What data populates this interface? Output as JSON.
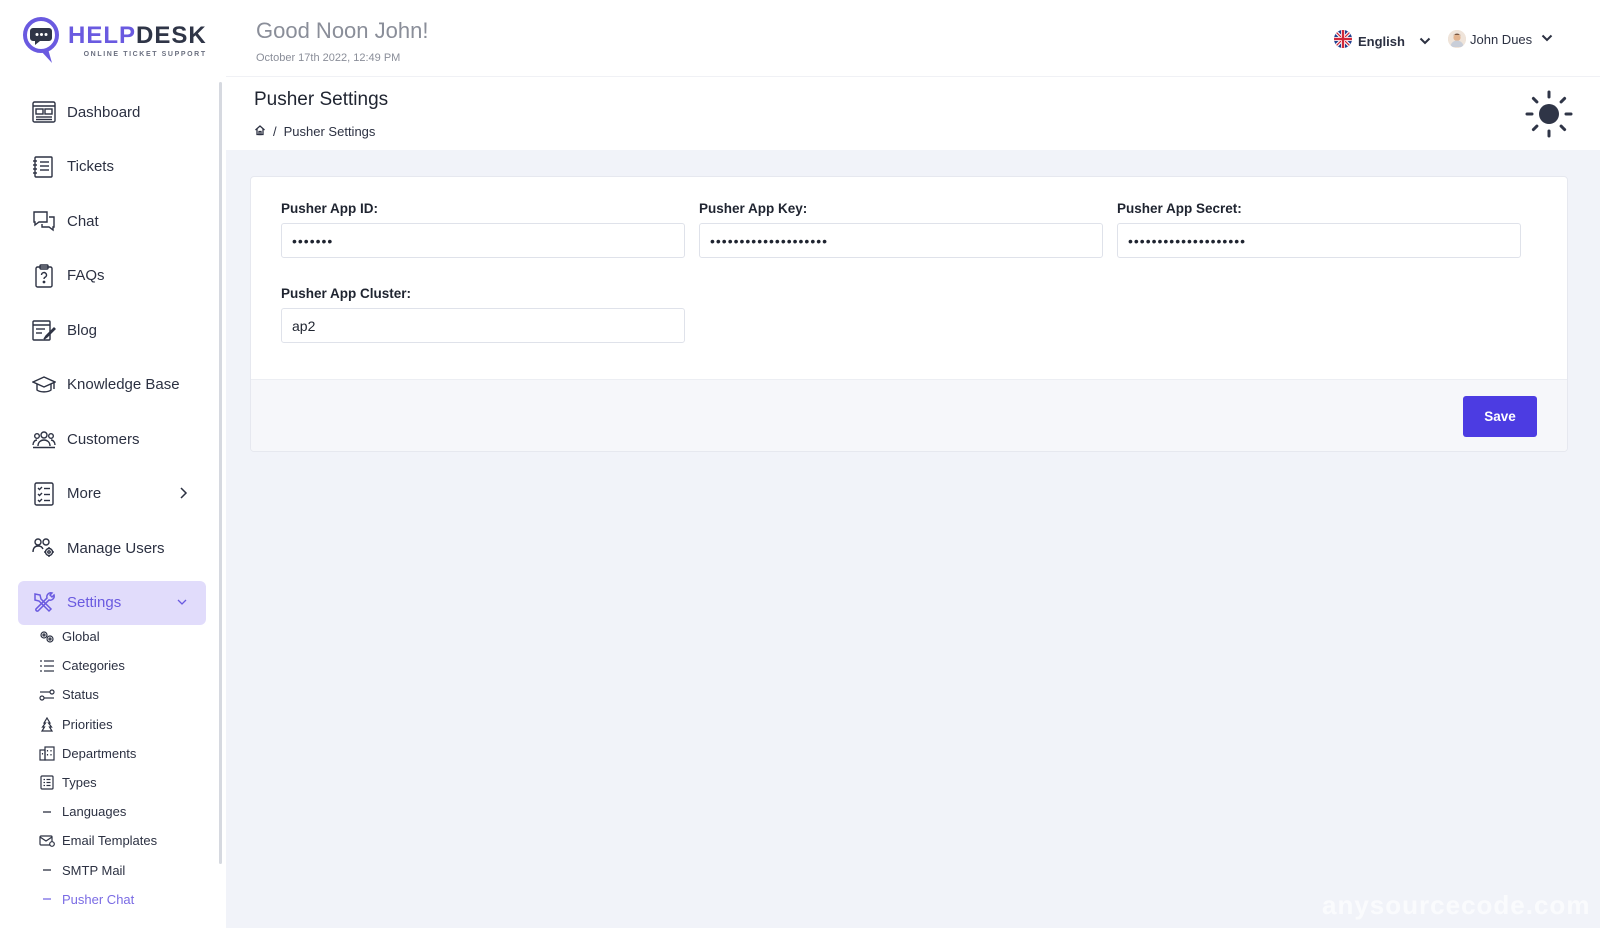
{
  "brand": {
    "name_a": "HELP",
    "name_b": "DESK",
    "tagline": "ONLINE TICKET SUPPORT"
  },
  "header": {
    "greeting": "Good Noon John!",
    "datetime": "October 17th 2022, 12:49 PM",
    "language": "English",
    "user_name": "John Dues"
  },
  "sidebar": {
    "items": [
      {
        "label": "Dashboard",
        "icon": "dashboard-icon"
      },
      {
        "label": "Tickets",
        "icon": "tickets-icon"
      },
      {
        "label": "Chat",
        "icon": "chat-icon"
      },
      {
        "label": "FAQs",
        "icon": "faq-icon"
      },
      {
        "label": "Blog",
        "icon": "blog-icon"
      },
      {
        "label": "Knowledge Base",
        "icon": "graduation-cap-icon"
      },
      {
        "label": "Customers",
        "icon": "customers-icon"
      },
      {
        "label": "More",
        "icon": "list-icon"
      },
      {
        "label": "Manage Users",
        "icon": "manage-users-icon"
      },
      {
        "label": "Settings",
        "icon": "settings-tools-icon"
      }
    ],
    "settings_sub": [
      {
        "label": "Global",
        "icon": "gears-icon"
      },
      {
        "label": "Categories",
        "icon": "list-bullets-icon"
      },
      {
        "label": "Status",
        "icon": "status-icon"
      },
      {
        "label": "Priorities",
        "icon": "priorities-icon"
      },
      {
        "label": "Departments",
        "icon": "departments-icon"
      },
      {
        "label": "Types",
        "icon": "types-icon"
      },
      {
        "label": "Languages",
        "icon": "dash-icon"
      },
      {
        "label": "Email Templates",
        "icon": "email-icon"
      },
      {
        "label": "SMTP Mail",
        "icon": "dash-icon"
      },
      {
        "label": "Pusher Chat",
        "icon": "dash-icon"
      }
    ],
    "active_item": "Settings",
    "active_sub": "Pusher Chat"
  },
  "page": {
    "title": "Pusher Settings",
    "breadcrumb_current": "Pusher Settings",
    "breadcrumb_sep": "/"
  },
  "form": {
    "app_id_label": "Pusher App ID:",
    "app_id_value": "•••••••",
    "app_key_label": "Pusher App Key:",
    "app_key_value": "••••••••••••••••••••",
    "app_secret_label": "Pusher App Secret:",
    "app_secret_value": "••••••••••••••••••••",
    "app_cluster_label": "Pusher App Cluster:",
    "app_cluster_value": "ap2",
    "save_label": "Save"
  },
  "watermark": "anysourcecode.com",
  "colors": {
    "accent": "#4c3ce2",
    "brand": "#6a5ae0",
    "active_bg": "#e1dcfb",
    "background": "#f1f3f9"
  }
}
